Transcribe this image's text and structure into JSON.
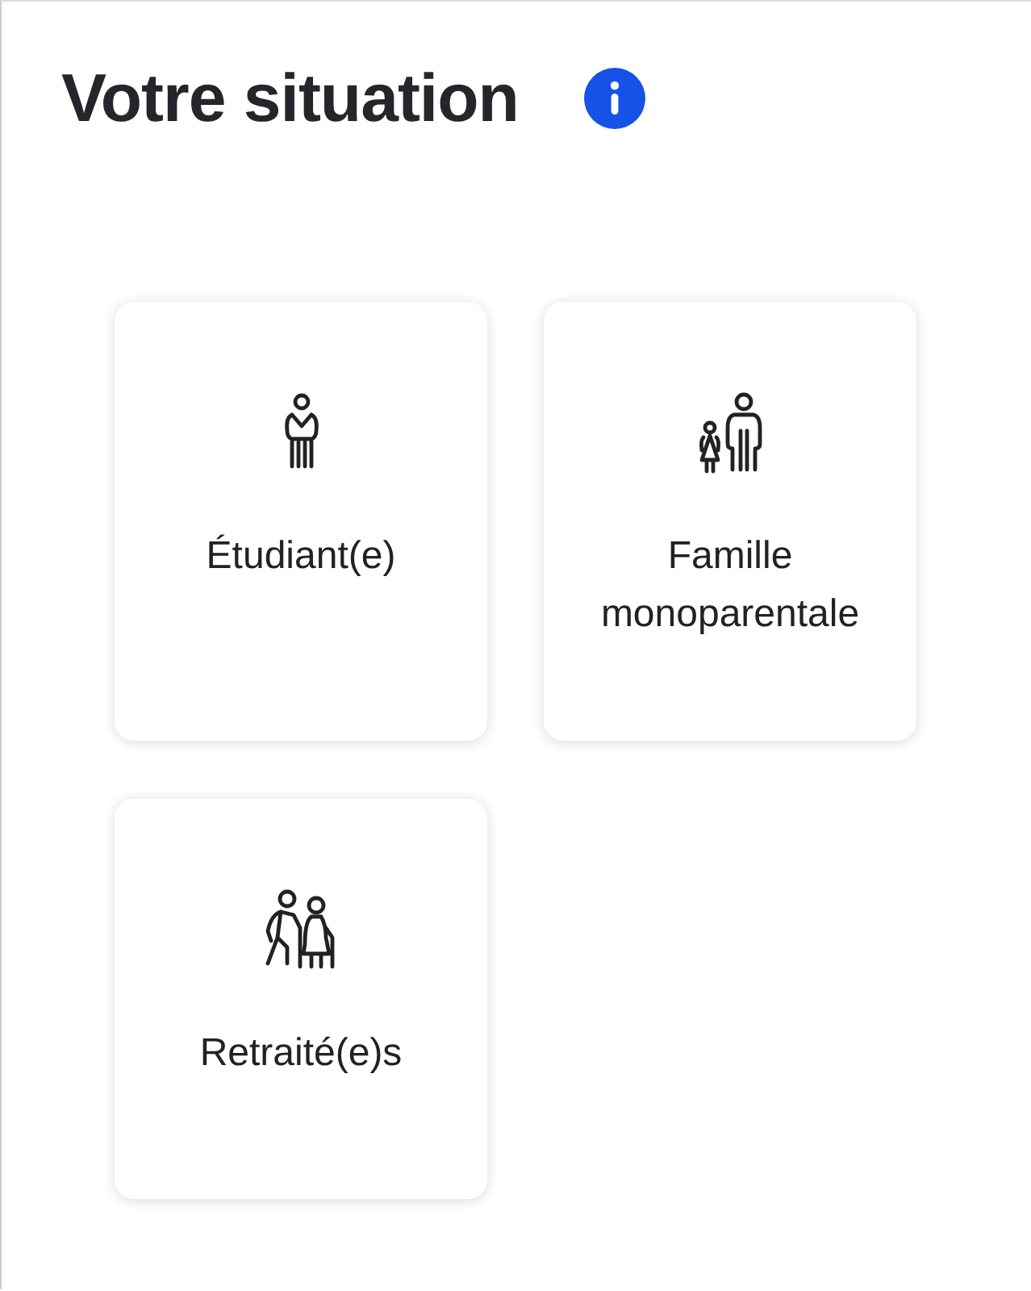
{
  "title": "Votre situation",
  "options": [
    {
      "kind": "student",
      "label": "Étudiant(e)"
    },
    {
      "kind": "single_parent",
      "label": "Famille monoparentale"
    },
    {
      "kind": "retired",
      "label": "Retraité(e)s"
    }
  ]
}
